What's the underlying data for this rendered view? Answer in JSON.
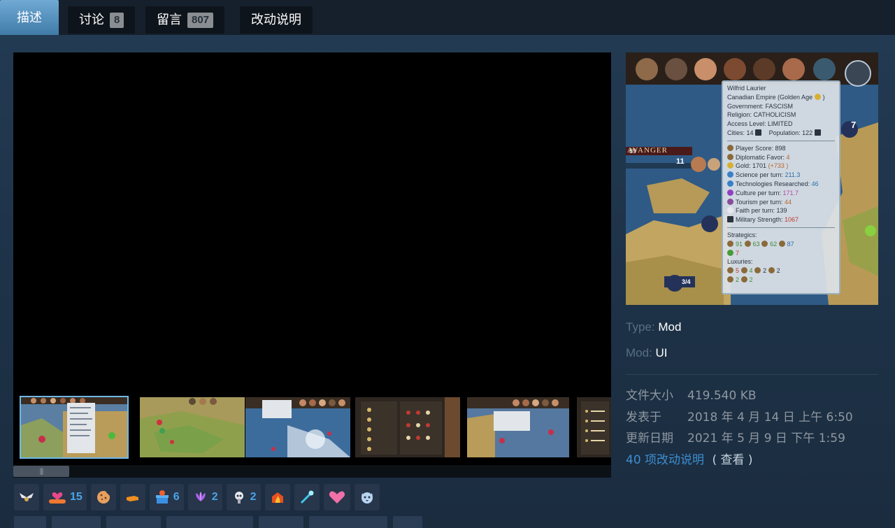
{
  "tabs": [
    {
      "label": "描述",
      "active": true
    },
    {
      "label": "讨论",
      "count": "8"
    },
    {
      "label": "留言",
      "count": "807"
    },
    {
      "label": "改动说明"
    }
  ],
  "tooltip": {
    "leader": "Wilfrid Laurier",
    "civ": "Canadian Empire (Golden Age",
    "government": "Government: FASCISM",
    "religion": "Religion: CATHOLICISM",
    "access": "Access Level: LIMITED",
    "cities": "Cities: 14",
    "population": "Population: 122",
    "score": "Player Score: 898",
    "favor_label": "Diplomatic Favor: ",
    "favor": "4",
    "gold_label": "Gold: 1701",
    "gold_plus": "(+733 )",
    "science_label": "Science per turn: ",
    "science": "211.3",
    "tech_label": "Technologies Researched: ",
    "tech": "46",
    "culture_label": "Culture per turn: ",
    "culture": "171.7",
    "tourism_label": "Tourism per turn: ",
    "tourism": "44",
    "faith": "Faith per turn: 139",
    "military_label": "Military Strength: ",
    "military": "1067",
    "strategics": "Strategics:",
    "strategic_values": [
      "91",
      "63",
      "62",
      "87",
      "7"
    ],
    "luxuries": "Luxuries:",
    "luxury_values": [
      "5",
      "4",
      "2",
      "2",
      "2",
      "2"
    ],
    "map_label": "AVANGER",
    "unit_11": "11",
    "unit_89": "89",
    "counter": "3/4",
    "turn_7": "7"
  },
  "meta": {
    "type_label": "Type:",
    "type_value": "Mod",
    "mod_label": "Mod:",
    "mod_value": "UI"
  },
  "details": {
    "size_label": "文件大小",
    "size_value": "419.540 KB",
    "posted_label": "发表于",
    "posted_value": "2018 年 4 月 14 日 上午 6:50",
    "updated_label": "更新日期",
    "updated_value": "2021 年 5 月 9 日 下午 1:59"
  },
  "changenotes": {
    "link": "40 项改动说明",
    "view": "( 查看 )"
  },
  "awards": [
    {
      "icon": "wings-icon",
      "count": ""
    },
    {
      "icon": "heart-hands-icon",
      "count": "15"
    },
    {
      "icon": "cookie-icon",
      "count": ""
    },
    {
      "icon": "thumb-hand-icon",
      "count": ""
    },
    {
      "icon": "gift-icon",
      "count": "6"
    },
    {
      "icon": "lotus-icon",
      "count": "2"
    },
    {
      "icon": "mind-blown-icon",
      "count": "2"
    },
    {
      "icon": "fire-house-icon",
      "count": ""
    },
    {
      "icon": "comet-icon",
      "count": ""
    },
    {
      "icon": "love-heart-icon",
      "count": ""
    },
    {
      "icon": "tiger-icon",
      "count": ""
    }
  ],
  "colors": {
    "accent": "#4aa3e8",
    "tab_active": "#5896c4",
    "bg": "#1b2838"
  }
}
